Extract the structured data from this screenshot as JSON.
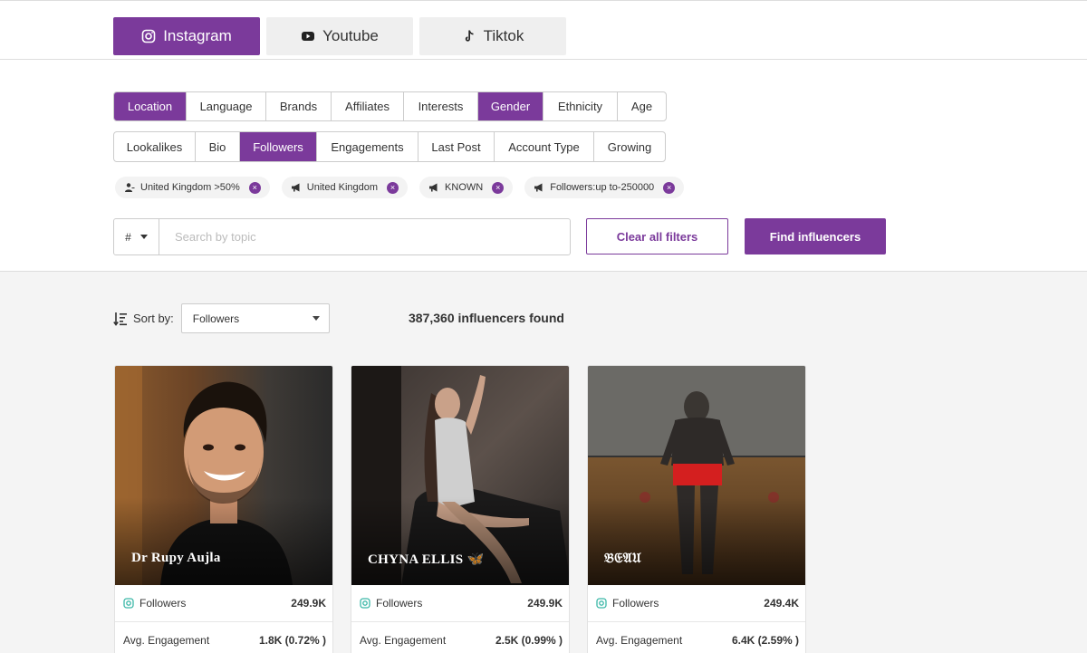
{
  "platform_tabs": [
    {
      "label": "Instagram",
      "icon": "instagram-icon",
      "active": true
    },
    {
      "label": "Youtube",
      "icon": "youtube-icon",
      "active": false
    },
    {
      "label": "Tiktok",
      "icon": "tiktok-icon",
      "active": false
    }
  ],
  "filters_row1": [
    {
      "label": "Location",
      "active": true
    },
    {
      "label": "Language",
      "active": false
    },
    {
      "label": "Brands",
      "active": false
    },
    {
      "label": "Affiliates",
      "active": false
    },
    {
      "label": "Interests",
      "active": false
    },
    {
      "label": "Gender",
      "active": true
    },
    {
      "label": "Ethnicity",
      "active": false
    },
    {
      "label": "Age",
      "active": false
    }
  ],
  "filters_row2": [
    {
      "label": "Lookalikes",
      "active": false
    },
    {
      "label": "Bio",
      "active": false
    },
    {
      "label": "Followers",
      "active": true
    },
    {
      "label": "Engagements",
      "active": false
    },
    {
      "label": "Last Post",
      "active": false
    },
    {
      "label": "Account Type",
      "active": false
    },
    {
      "label": "Growing",
      "active": false
    }
  ],
  "chips": [
    {
      "label": "United Kingdom >50%",
      "icon": "audience-icon"
    },
    {
      "label": "United Kingdom",
      "icon": "megaphone-icon"
    },
    {
      "label": "KNOWN",
      "icon": "megaphone-icon"
    },
    {
      "label": "Followers:up to-250000",
      "icon": "megaphone-icon"
    }
  ],
  "chip_remove_glyph": "×",
  "search": {
    "prefix": "#",
    "placeholder": "Search by topic",
    "value": ""
  },
  "buttons": {
    "clear": "Clear all filters",
    "find": "Find influencers"
  },
  "sort": {
    "label": "Sort by:",
    "selected": "Followers"
  },
  "results_count": "387,360 influencers found",
  "cards": [
    {
      "name": "Dr Rupy Aujla",
      "followers_label": "Followers",
      "followers": "249.9K",
      "engagement_label": "Avg. Engagement",
      "engagement": "1.8K (0.72% )"
    },
    {
      "name": "CHYNA ELLIS 🦋",
      "followers_label": "Followers",
      "followers": "249.9K",
      "engagement_label": "Avg. Engagement",
      "engagement": "2.5K (0.99% )"
    },
    {
      "name": "𝔅𝔈𝔄𝔘",
      "followers_label": "Followers",
      "followers": "249.4K",
      "engagement_label": "Avg. Engagement",
      "engagement": "6.4K (2.59% )"
    }
  ],
  "colors": {
    "accent": "#7b3a9b",
    "ig_icon": "#3cb8a8"
  }
}
